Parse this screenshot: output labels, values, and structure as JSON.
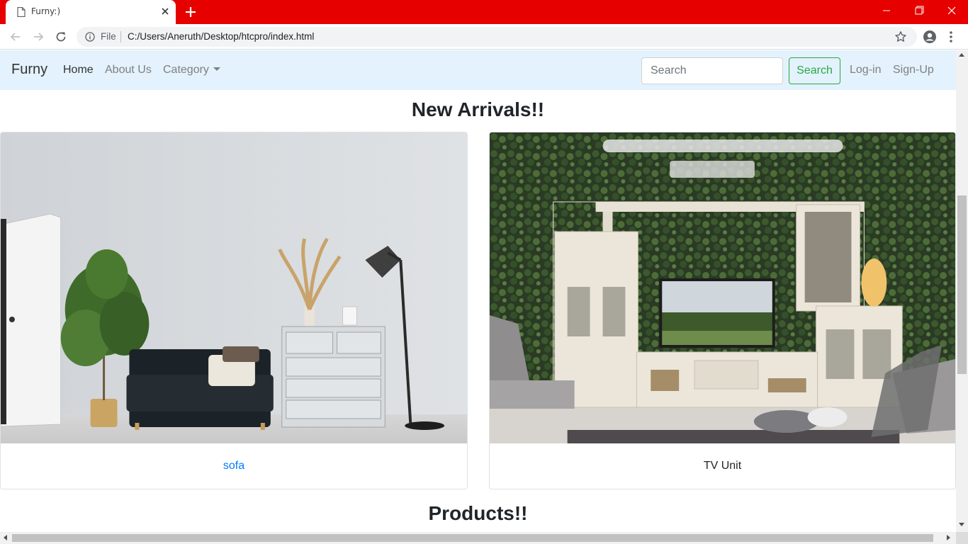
{
  "browser": {
    "tab_title": "Furny:)",
    "address_scheme": "File",
    "address_url": "C:/Users/Aneruth/Desktop/htcpro/index.html",
    "accent_color": "#e60000"
  },
  "navbar": {
    "brand": "Furny",
    "links": [
      {
        "label": "Home",
        "active": true
      },
      {
        "label": "About Us",
        "active": false
      },
      {
        "label": "Category",
        "active": false,
        "dropdown": true
      }
    ],
    "search_placeholder": "Search",
    "search_button": "Search",
    "login": "Log-in",
    "signup": "Sign-Up",
    "background": "#e3f2fd"
  },
  "main": {
    "new_arrivals_title": "New Arrivals!!",
    "cards": [
      {
        "caption": "sofa",
        "caption_style": "link",
        "image": "living-room-sofa-photo"
      },
      {
        "caption": "TV Unit",
        "caption_style": "text",
        "image": "tv-unit-photo"
      }
    ],
    "products_title": "Products!!"
  }
}
